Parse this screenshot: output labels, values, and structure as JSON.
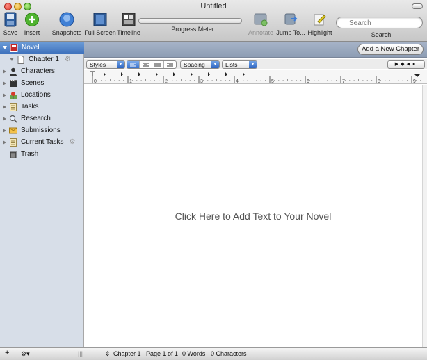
{
  "window": {
    "title": "Untitled"
  },
  "toolbar": {
    "save": "Save",
    "insert": "Insert",
    "snapshots": "Snapshots",
    "full_screen": "Full Screen",
    "timeline": "Timeline",
    "progress_meter": "Progress Meter",
    "annotate": "Annotate",
    "jump_to": "Jump To...",
    "highlight": "Highlight",
    "search_label": "Search",
    "search_placeholder": "Search"
  },
  "sidebar": {
    "items": [
      {
        "label": "Novel",
        "icon": "novel-icon",
        "selected": true
      },
      {
        "label": "Chapter 1",
        "icon": "document-icon"
      },
      {
        "label": "Characters",
        "icon": "person-icon"
      },
      {
        "label": "Scenes",
        "icon": "clapperboard-icon"
      },
      {
        "label": "Locations",
        "icon": "pin-icon"
      },
      {
        "label": "Tasks",
        "icon": "checklist-icon"
      },
      {
        "label": "Research",
        "icon": "magnifier-icon"
      },
      {
        "label": "Submissions",
        "icon": "envelope-icon"
      },
      {
        "label": "Current Tasks",
        "icon": "checklist-icon"
      },
      {
        "label": "Trash",
        "icon": "trash-icon"
      }
    ]
  },
  "main": {
    "add_chapter": "Add a New Chapter",
    "placeholder": "Click Here to Add Text to Your Novel"
  },
  "format_bar": {
    "styles": "Styles",
    "spacing": "Spacing",
    "lists": "Lists"
  },
  "ruler": {
    "marks": [
      "0",
      "1",
      "2",
      "3",
      "4",
      "5",
      "6",
      "7",
      "8",
      "9"
    ]
  },
  "status": {
    "chapter": "Chapter 1",
    "page": "Page 1 of 1",
    "words": "0 Words",
    "characters": "0 Characters"
  },
  "colors": {
    "selection": "#3f72bd",
    "sidebar": "#d7dee8",
    "header": "#98a7bd"
  }
}
